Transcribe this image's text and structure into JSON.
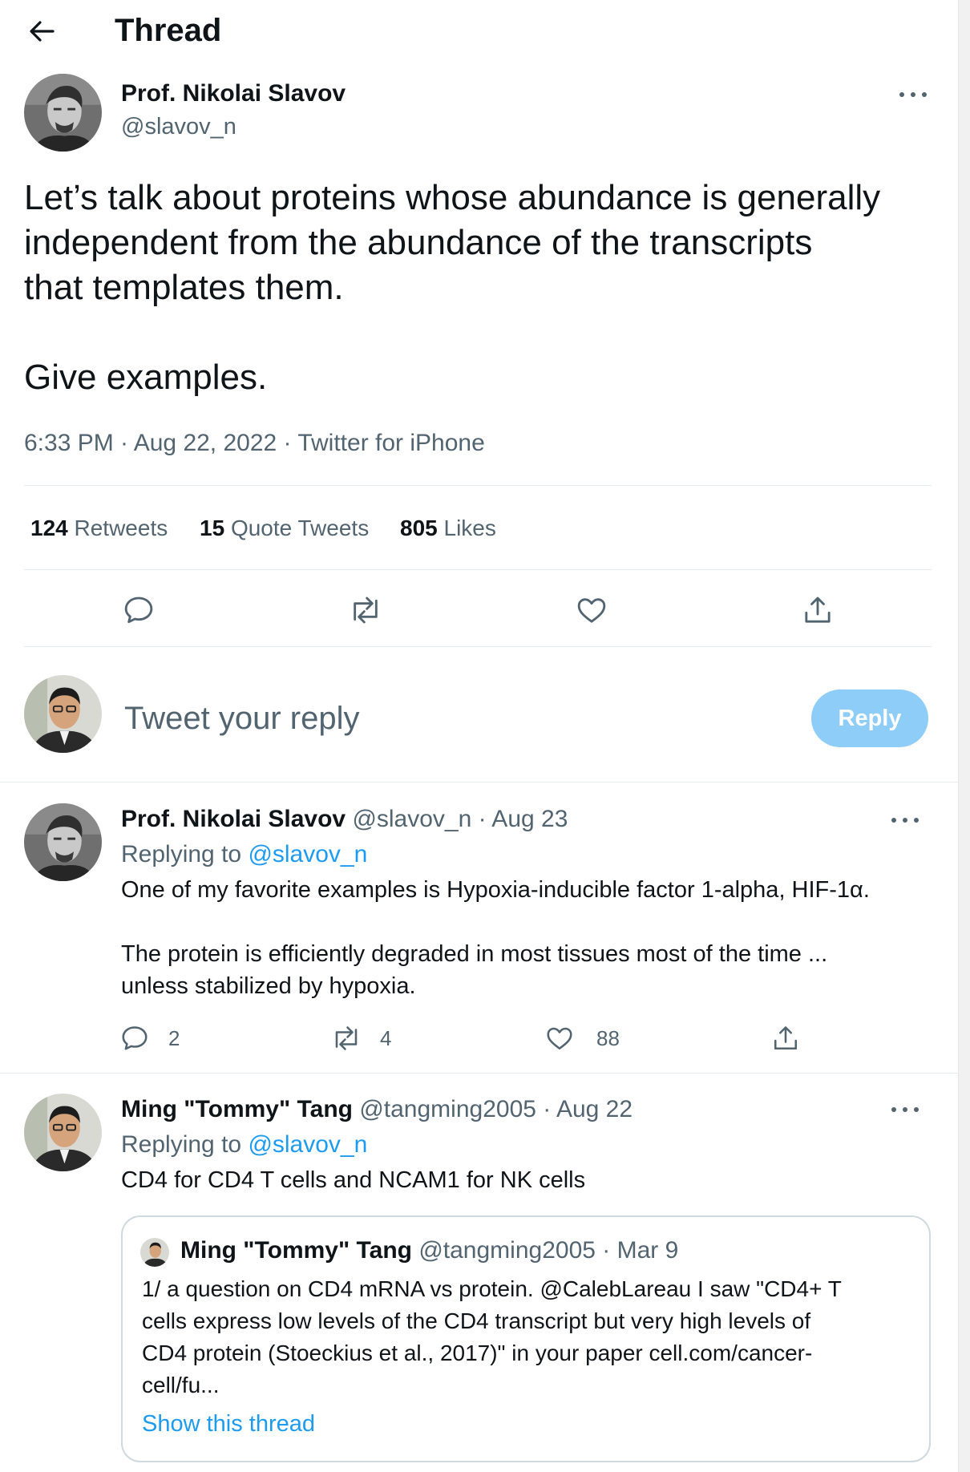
{
  "header": {
    "title": "Thread"
  },
  "main_tweet": {
    "name": "Prof. Nikolai Slavov",
    "handle": "@slavov_n",
    "text_line1": "Let’s talk about proteins whose abundance is generally",
    "text_line2": "independent from the abundance of the transcripts",
    "text_line3": "that templates them.",
    "text_line4": "Give examples.",
    "meta": "6:33 PM · Aug 22, 2022 · Twitter for iPhone",
    "stats": {
      "retweets_count": "124",
      "retweets_label": "Retweets",
      "quotes_count": "15",
      "quotes_label": "Quote Tweets",
      "likes_count": "805",
      "likes_label": "Likes"
    }
  },
  "composer": {
    "placeholder": "Tweet your reply",
    "button_label": "Reply"
  },
  "reply1": {
    "name": "Prof. Nikolai Slavov",
    "handle": "@slavov_n",
    "date": "· Aug 23",
    "replying_prefix": "Replying to",
    "replying_handle": "@slavov_n",
    "line1": "One of my favorite examples is Hypoxia-inducible factor 1-alpha, HIF-1α.",
    "line2": "The protein is efficiently degraded in most tissues most of the time ...",
    "line3": "unless stabilized by hypoxia.",
    "reply_count": "2",
    "retweet_count": "4",
    "like_count": "88"
  },
  "reply2": {
    "name": "Ming \"Tommy\" Tang",
    "handle": "@tangming2005",
    "date": "· Aug 22",
    "replying_prefix": "Replying to",
    "replying_handle": "@slavov_n",
    "text": "CD4 for CD4 T cells and NCAM1 for NK cells"
  },
  "quoted_tweet": {
    "name": "Ming \"Tommy\" Tang",
    "handle": "@tangming2005",
    "date": "· Mar 9",
    "line1": "1/ a question on CD4 mRNA vs protein. @CalebLareau I saw \"CD4+ T",
    "line2": "cells express low levels of the CD4 transcript but very high levels of",
    "line3": "CD4 protein (Stoeckius et al., 2017)\" in your paper  cell.com/cancer-",
    "line4": "cell/fu...",
    "show_thread": "Show this thread"
  },
  "colors": {
    "accent": "#1d9bf0",
    "reply_button_disabled": "#8ecdf8",
    "text_primary": "#0f1419",
    "text_secondary": "#536471",
    "divider": "#e6ecf0"
  },
  "icons": [
    "back-arrow-icon",
    "more-icon",
    "reply-icon",
    "retweet-icon",
    "like-icon",
    "share-icon"
  ]
}
